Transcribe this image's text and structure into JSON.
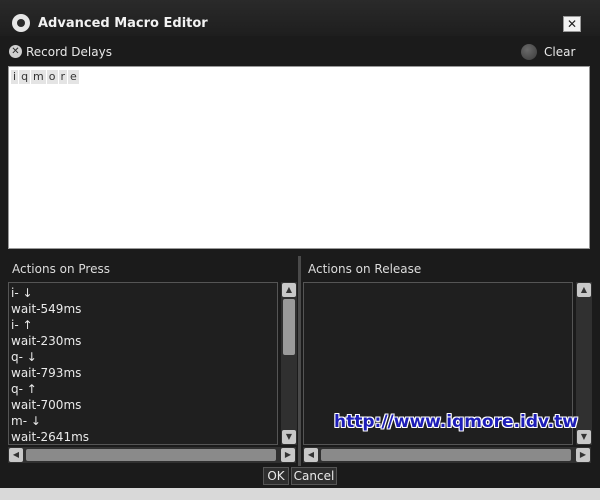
{
  "window": {
    "title": "Advanced Macro Editor",
    "close_label": "✕"
  },
  "toolbar": {
    "record_delays_label": "Record Delays",
    "clear_label": "Clear"
  },
  "editor": {
    "chips": [
      "i",
      "q",
      "m",
      "o",
      "r",
      "e"
    ]
  },
  "press_panel": {
    "header": "Actions on Press",
    "items": [
      "i- ↓",
      "wait-549ms",
      "i- ↑",
      "wait-230ms",
      "q- ↓",
      "wait-793ms",
      "q- ↑",
      "wait-700ms",
      "m- ↓",
      "wait-2641ms"
    ]
  },
  "release_panel": {
    "header": "Actions on Release",
    "items": []
  },
  "watermark": "http://www.iqmore.idv.tw",
  "buttons": {
    "ok": "OK",
    "cancel": "Cancel"
  },
  "colors": {
    "background": "#1b1b1b",
    "editor_bg": "#ffffff",
    "watermark": "#1d1db8"
  }
}
